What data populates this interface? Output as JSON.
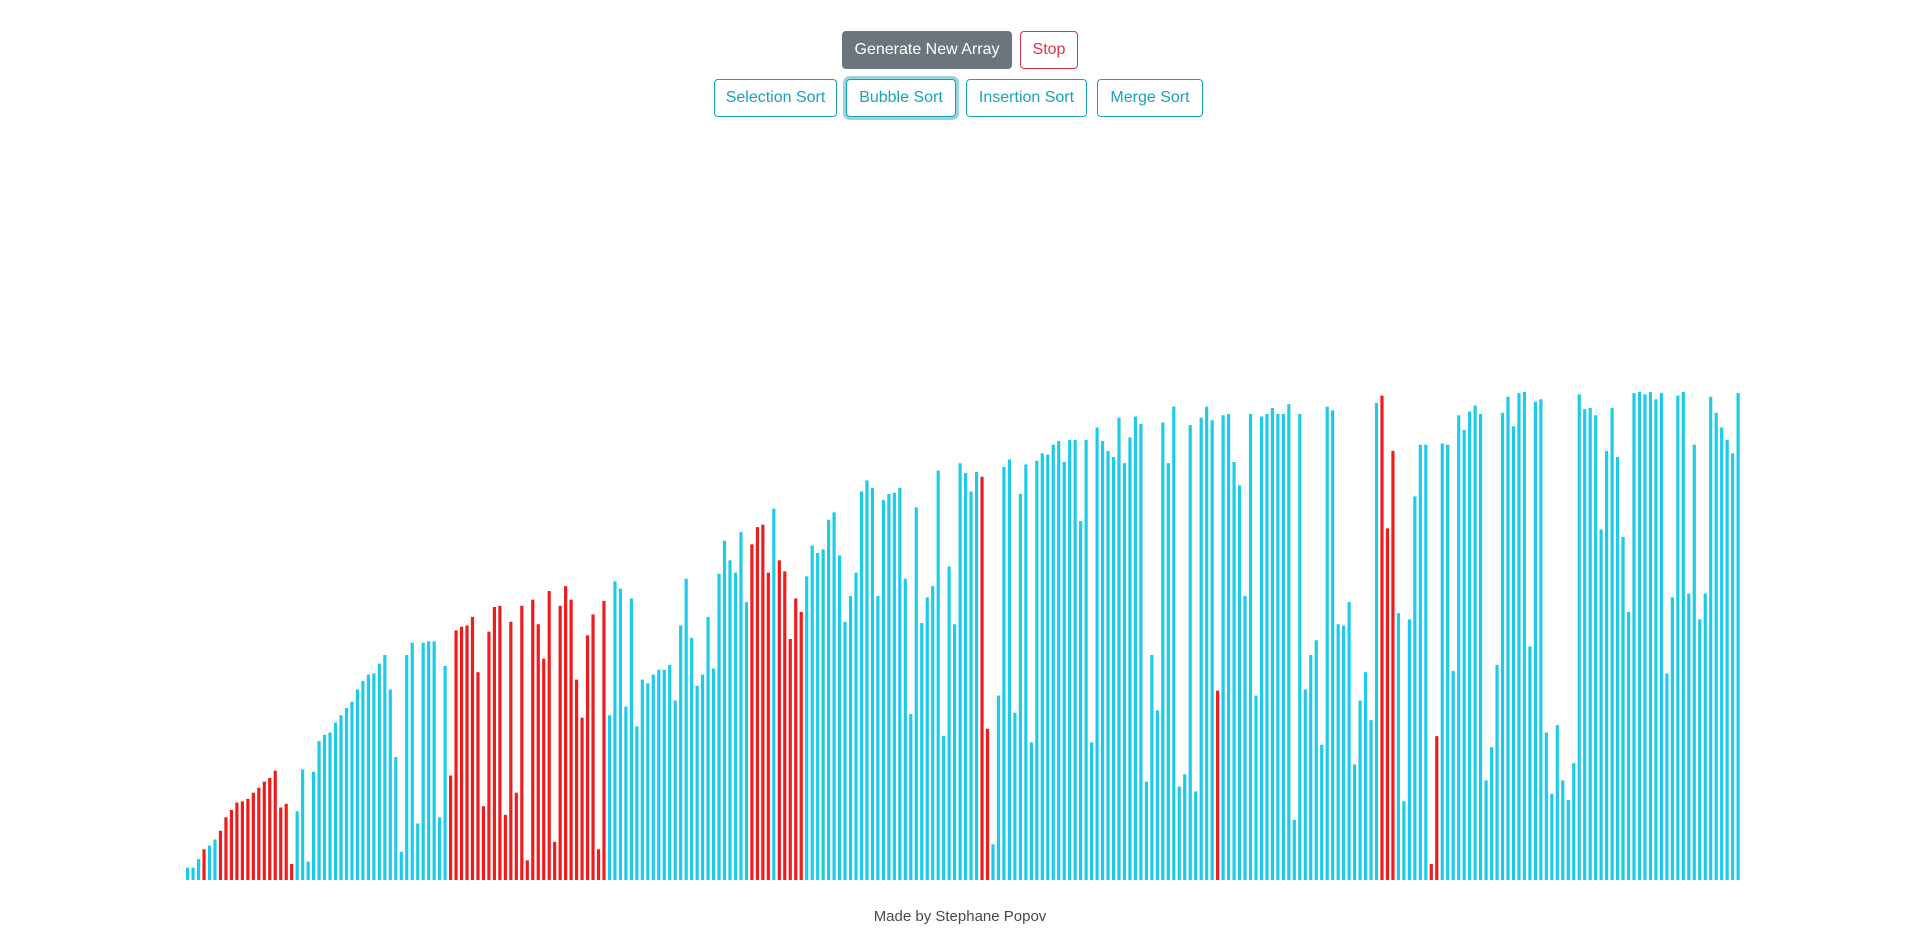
{
  "controls": {
    "generate_label": "Generate New Array",
    "stop_label": "Stop"
  },
  "algorithms": {
    "selection_label": "Selection Sort",
    "bubble_label": "Bubble Sort",
    "insertion_label": "Insertion Sort",
    "merge_label": "Merge Sort",
    "active": "Bubble Sort"
  },
  "footer": {
    "credit": "Made by Stephane Popov"
  },
  "colors": {
    "bar_default": "#1bcbe8",
    "bar_compare": "#ee1c1c",
    "accent": "#17a2b8",
    "danger": "#dc3545",
    "secondary": "#6c757d"
  },
  "array": {
    "max_value": 610,
    "values": [
      10,
      10,
      17,
      25,
      28,
      33,
      40,
      51,
      57,
      63,
      64,
      66,
      71,
      75,
      80,
      83,
      89,
      59,
      62,
      13,
      56,
      90,
      15,
      88,
      113,
      118,
      120,
      128,
      134,
      140,
      145,
      155,
      162,
      167,
      168,
      176,
      183,
      155,
      100,
      23,
      183,
      193,
      46,
      193,
      194,
      194,
      51,
      174,
      85,
      203,
      206,
      207,
      214,
      169,
      60,
      202,
      222,
      223,
      53,
      210,
      71,
      223,
      16,
      228,
      208,
      180,
      235,
      31,
      223,
      239,
      228,
      163,
      132,
      199,
      216,
      25,
      227,
      134,
      243,
      237,
      141,
      229,
      125,
      163,
      160,
      167,
      171,
      171,
      175,
      146,
      207,
      245,
      197,
      158,
      167,
      214,
      172,
      249,
      276,
      260,
      250,
      283,
      226,
      273,
      287,
      289,
      250,
      302,
      260,
      251,
      196,
      229,
      218,
      247,
      272,
      266,
      269,
      293,
      299,
      264,
      210,
      231,
      250,
      316,
      325,
      319,
      231,
      309,
      314,
      315,
      319,
      245,
      135,
      303,
      209,
      230,
      239,
      333,
      117,
      255,
      208,
      339,
      331,
      316,
      332,
      328,
      123,
      29,
      150,
      336,
      342,
      136,
      314,
      338,
      112,
      341,
      347,
      346,
      354,
      357,
      340,
      358,
      358,
      292,
      358,
      112,
      368,
      357,
      349,
      344,
      376,
      339,
      360,
      377,
      371,
      80,
      183,
      138,
      372,
      339,
      385,
      76,
      86,
      370,
      72,
      376,
      385,
      374,
      154,
      378,
      379,
      340,
      321,
      231,
      379,
      150,
      377,
      379,
      384,
      379,
      379,
      387,
      49,
      379,
      155,
      183,
      195,
      110,
      385,
      382,
      208,
      207,
      226,
      94,
      146,
      169,
      130,
      388,
      394,
      286,
      349,
      217,
      64,
      212,
      312,
      354,
      354,
      13,
      117,
      355,
      354,
      170,
      378,
      366,
      381,
      386,
      379,
      81,
      108,
      175,
      380,
      393,
      369,
      396,
      397,
      190,
      389,
      391,
      120,
      70,
      126,
      81,
      65,
      95,
      395,
      383,
      384,
      378,
      285,
      349,
      384,
      344,
      279,
      218,
      396,
      397,
      395,
      397,
      391,
      396,
      168,
      230,
      394,
      397,
      233,
      354,
      212,
      233,
      393,
      380,
      368,
      358,
      347,
      396
    ],
    "compare_ranges": [
      [
        6,
        19
      ],
      [
        48,
        76
      ],
      [
        103,
        106
      ],
      [
        108,
        112
      ],
      [
        145,
        146
      ],
      [
        188,
        188
      ],
      [
        218,
        220
      ],
      [
        227,
        228
      ]
    ],
    "compare_extra": [
      3,
      13,
      18
    ]
  }
}
